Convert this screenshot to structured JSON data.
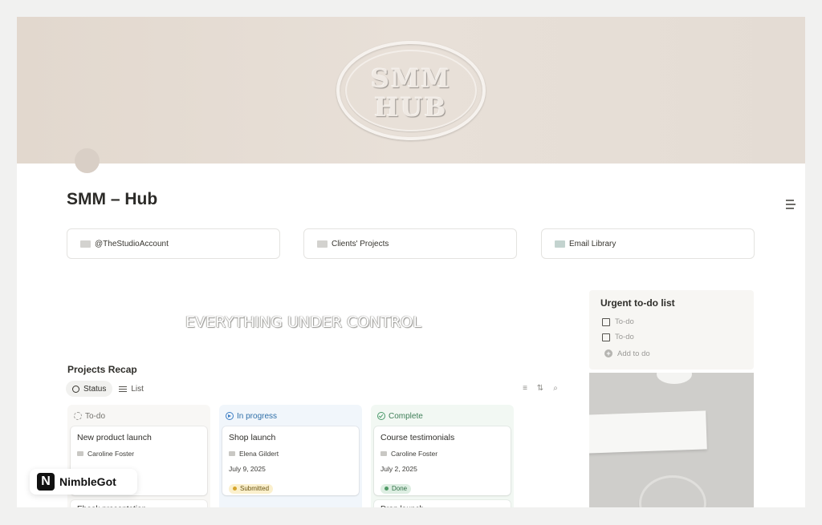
{
  "cover": {
    "logo_line1": "SMM",
    "logo_line2": "HUB"
  },
  "page": {
    "title": "SMM – Hub"
  },
  "links": [
    {
      "label": "@TheStudioAccount",
      "icon": "folder-icon"
    },
    {
      "label": "Clients' Projects",
      "icon": "folder-icon"
    },
    {
      "label": "Email Library",
      "icon": "folder-icon"
    }
  ],
  "tagline": "EVERYTHING UNDER CONTROL",
  "projects": {
    "title": "Projects Recap",
    "views": [
      "Status",
      "List"
    ],
    "tools": [
      "filter-icon",
      "sort-icon",
      "search-icon"
    ],
    "columns": [
      {
        "name": "To-do",
        "card": {
          "title": "New product launch",
          "person": "Caroline Foster"
        },
        "card2": "Ebook presentation"
      },
      {
        "name": "In progress",
        "card": {
          "title": "Shop launch",
          "person": "Elena Gildert",
          "date": "July 9, 2025",
          "status": "Submitted"
        }
      },
      {
        "name": "Complete",
        "card": {
          "title": "Course testimonials",
          "person": "Caroline Foster",
          "date": "July 2, 2025",
          "status": "Done"
        },
        "card2": "Drop launch"
      }
    ]
  },
  "todo": {
    "title": "Urgent to-do list",
    "items": [
      "To-do",
      "To-do"
    ],
    "add_label": "Add to do"
  },
  "watermark": {
    "logo": "N",
    "text": "NimbleGot"
  },
  "colors": {
    "cover": "#e4dbd2",
    "todo_column": "#f8f7f5",
    "in_progress_column": "#f1f6fb",
    "complete_column": "#f2f8f3",
    "submitted_pill": "#fbf0cd",
    "done_pill": "#ddeee2"
  }
}
